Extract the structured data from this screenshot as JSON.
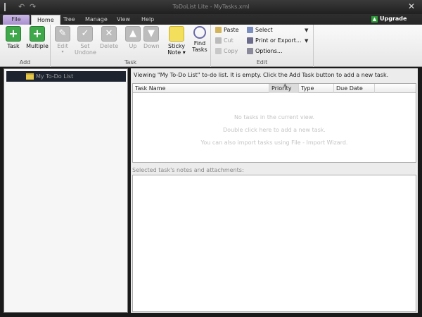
{
  "window": {
    "title": "ToDoList Lite - MyTasks.xml"
  },
  "tabs": [
    {
      "label": "File"
    },
    {
      "label": "Home"
    },
    {
      "label": "Tree"
    },
    {
      "label": "Manage"
    },
    {
      "label": "View"
    },
    {
      "label": "Help"
    }
  ],
  "upgrade_label": "Upgrade",
  "ribbon": {
    "add": {
      "label": "Add",
      "task": "Task",
      "multiple": "Multiple"
    },
    "task": {
      "label": "Task",
      "edit": "Edit",
      "set_undone_1": "Set",
      "set_undone_2": "Undone",
      "delete": "Delete",
      "up": "Up",
      "down": "Down",
      "sticky_1": "Sticky",
      "sticky_2": "Note",
      "find_1": "Find",
      "find_2": "Tasks"
    },
    "edit": {
      "label": "Edit",
      "paste": "Paste",
      "cut": "Cut",
      "copy": "Copy",
      "select": "Select",
      "print": "Print or Export...",
      "options": "Options..."
    }
  },
  "tree": {
    "items": [
      {
        "label": "My To-Do List"
      }
    ]
  },
  "main": {
    "viewing_text": "Viewing \"My To-Do List\" to-do list. It is empty. Click the Add Task button to add a new task.",
    "columns": [
      "Task Name",
      "Priority",
      "Type",
      "Due Date"
    ],
    "empty_lines": [
      "No tasks in the current view.",
      "Double click here to add a new task.",
      "You can also import tasks using File - Import Wizard."
    ],
    "notes_label": "Selected task's notes and attachments:"
  },
  "colors": {
    "accent_green": "#3fa84a",
    "file_tab": "#b49cd9",
    "tree_selection": "#1d2430"
  }
}
